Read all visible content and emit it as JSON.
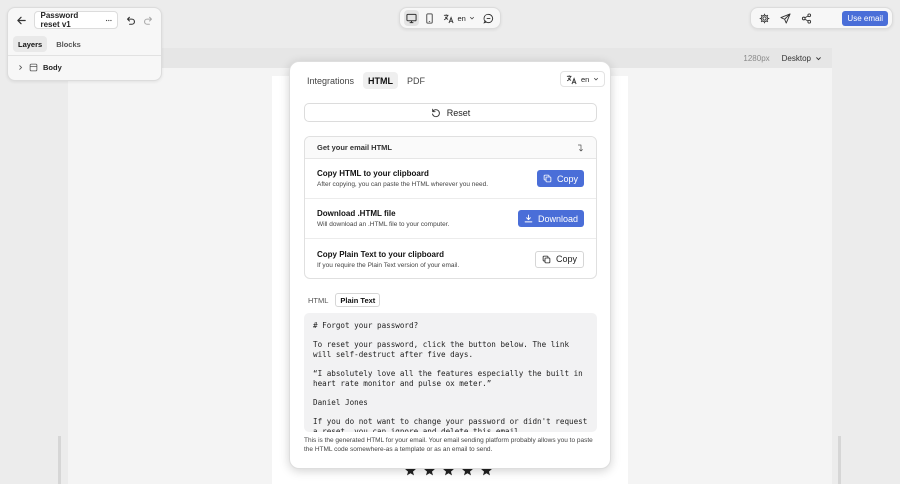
{
  "document": {
    "name": "Password reset v1"
  },
  "sidebar": {
    "tabs": [
      {
        "label": "Layers"
      },
      {
        "label": "Blocks"
      }
    ],
    "tree": {
      "root_label": "Body"
    }
  },
  "toolbar": {
    "language": "en"
  },
  "actions": {
    "use_email_label": "Use email"
  },
  "canvas": {
    "width_label": "1280px",
    "device_label": "Desktop"
  },
  "modal": {
    "tabs": [
      {
        "label": "Integrations"
      },
      {
        "label": "HTML"
      },
      {
        "label": "PDF"
      }
    ],
    "language": "en",
    "reset_label": "Reset",
    "section_title": "Get your email HTML",
    "rows": [
      {
        "title": "Copy HTML to your clipboard",
        "description": "After copying, you can paste the HTML wherever you need.",
        "button_label": "Copy"
      },
      {
        "title": "Download .HTML file",
        "description": "Will download an .HTML file to your computer.",
        "button_label": "Download"
      },
      {
        "title": "Copy Plain Text to your clipboard",
        "description": "If you require the Plain Text version of your email.",
        "button_label": "Copy"
      }
    ],
    "preview_tabs": [
      {
        "label": "HTML"
      },
      {
        "label": "Plain Text"
      }
    ],
    "plain_text_preview": "# Forgot your password?\n\nTo reset your password, click the button below. The link will self-destruct after five days.\n\n“I absolutely love all the features especially the built in heart rate monitor and pulse ox meter.”\n\nDaniel Jones\n\nIf you do not want to change your password or didn't request a reset, you can ignore and delete this email.",
    "footer_note": "This is the generated HTML for your email. Your email sending platform probably allows you to paste the HTML code somewhere-as a template or as an email to send."
  },
  "colors": {
    "accent": "#4a6ed8",
    "background": "#ececec"
  }
}
